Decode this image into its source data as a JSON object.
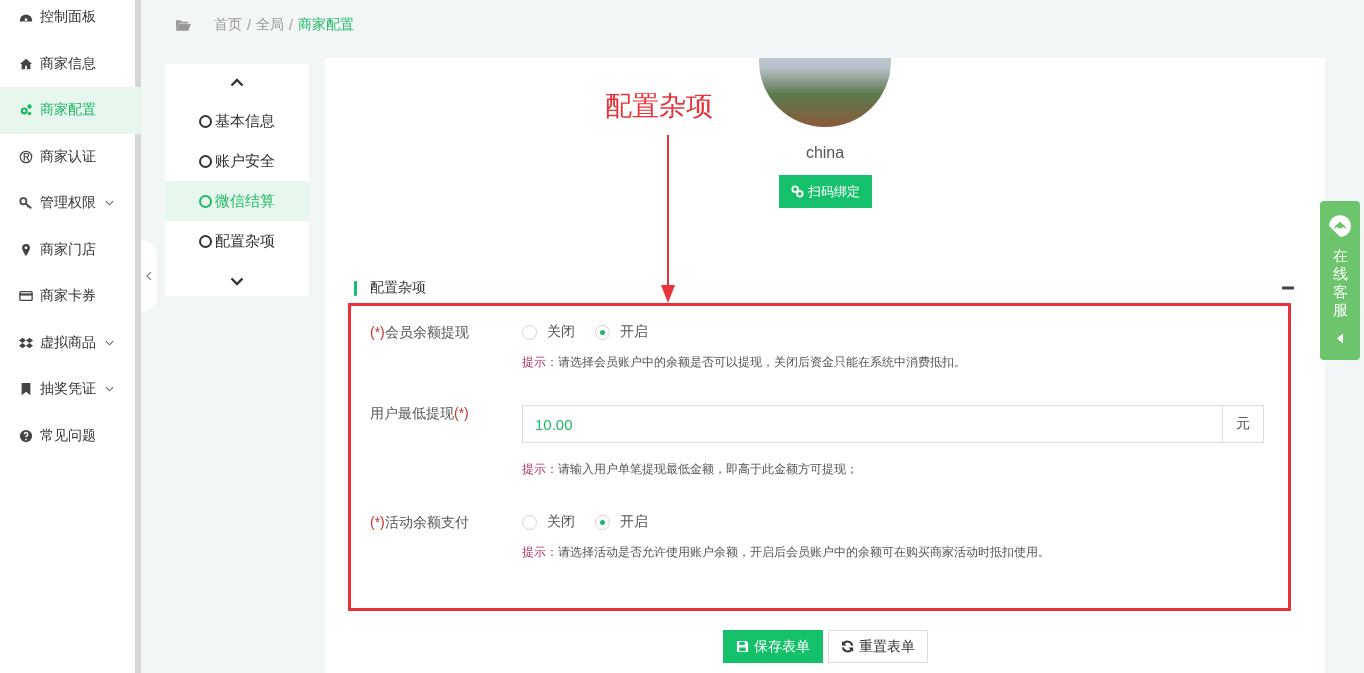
{
  "sidebar": {
    "items": [
      {
        "label": "控制面板",
        "selected": false,
        "has_submenu": false
      },
      {
        "label": "商家信息",
        "selected": false,
        "has_submenu": false
      },
      {
        "label": "商家配置",
        "selected": true,
        "has_submenu": false
      },
      {
        "label": "商家认证",
        "selected": false,
        "has_submenu": false
      },
      {
        "label": "管理权限",
        "selected": false,
        "has_submenu": true
      },
      {
        "label": "商家门店",
        "selected": false,
        "has_submenu": false
      },
      {
        "label": "商家卡券",
        "selected": false,
        "has_submenu": false
      },
      {
        "label": "虚拟商品",
        "selected": false,
        "has_submenu": true
      },
      {
        "label": "抽奖凭证",
        "selected": false,
        "has_submenu": true
      },
      {
        "label": "常见问题",
        "selected": false,
        "has_submenu": false
      }
    ]
  },
  "breadcrumb": [
    {
      "label": "首页",
      "selected": false
    },
    {
      "label": "全局",
      "selected": false
    },
    {
      "label": "商家配置",
      "selected": true
    }
  ],
  "breadcrumb_separator": "/",
  "sub_nav": {
    "items": [
      {
        "label": "基本信息",
        "selected": false
      },
      {
        "label": "账户安全",
        "selected": false
      },
      {
        "label": "微信结算",
        "selected": true
      },
      {
        "label": "配置杂项",
        "selected": false
      }
    ]
  },
  "profile": {
    "name": "china",
    "bind_button": "扫码绑定"
  },
  "annotation": {
    "text": "配置杂项"
  },
  "section": {
    "title": "配置杂项"
  },
  "fields": [
    {
      "kind": "radio",
      "label": "会员余额提现",
      "required_mark": "(*)",
      "mark_first": true,
      "options": [
        {
          "label": "关闭",
          "selected": false
        },
        {
          "label": "开启",
          "selected": true
        }
      ],
      "hint_prefix": "提示：",
      "hint": "请选择会员账户中的余额是否可以提现，关闭后资金只能在系统中消费抵扣。"
    },
    {
      "kind": "input",
      "label": "用户最低提现",
      "required_mark": "(*)",
      "mark_first": false,
      "value": "10.00",
      "suffix": "元",
      "hint_prefix": "提示：",
      "hint": "请输入用户单笔提现最低金额，即高于此金额方可提现；"
    },
    {
      "kind": "radio",
      "label": "活动余额支付",
      "required_mark": "(*)",
      "mark_first": true,
      "options": [
        {
          "label": "关闭",
          "selected": false
        },
        {
          "label": "开启",
          "selected": true
        }
      ],
      "hint_prefix": "提示：",
      "hint": "请选择活动是否允许使用账户余额，开启后会员账户中的余额可在购买商家活动时抵扣使用。"
    }
  ],
  "buttons": [
    {
      "kind": "save",
      "label": "保存表单"
    },
    {
      "kind": "reset",
      "label": "重置表单"
    }
  ],
  "chat_widget": {
    "text": "在线客服"
  }
}
